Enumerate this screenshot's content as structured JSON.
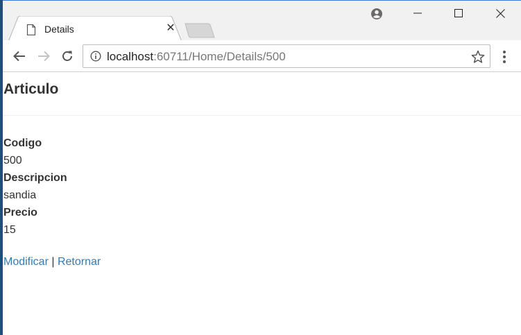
{
  "browser": {
    "tab": {
      "title": "Details"
    },
    "address_bar": {
      "host": "localhost",
      "path": ":60711/Home/Details/500"
    }
  },
  "page": {
    "heading": "Articulo",
    "fields": [
      {
        "label": "Codigo",
        "value": "500"
      },
      {
        "label": "Descripcion",
        "value": "sandia"
      },
      {
        "label": "Precio",
        "value": "15"
      }
    ],
    "links": {
      "edit": "Modificar",
      "separator": "|",
      "back": "Retornar"
    }
  },
  "colors": {
    "link": "#337ab7",
    "text": "#333333",
    "window_edge": "#1f4e79"
  },
  "icons": [
    "page-icon",
    "close-icon",
    "profile-icon",
    "minimize-icon",
    "maximize-icon",
    "window-close-icon",
    "back-icon",
    "forward-icon",
    "reload-icon",
    "info-icon",
    "star-icon",
    "menu-icon"
  ]
}
